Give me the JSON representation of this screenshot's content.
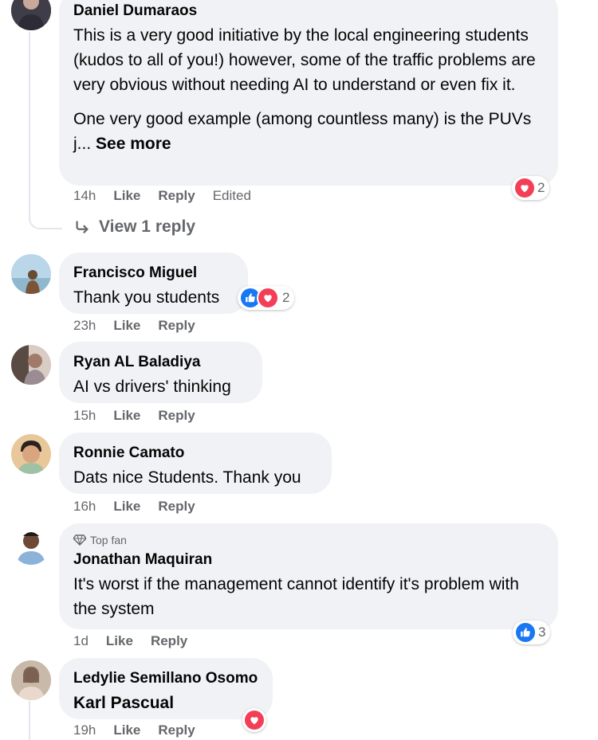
{
  "comments": [
    {
      "author": "Daniel Dumaraos",
      "paragraph1": "This is a very good initiative by the local engineering students (kudos to all of you!) however, some of the traffic problems are very obvious without needing AI to understand or even fix it.",
      "paragraph2": "One very good example (among countless many) is the PUVs j...",
      "see_more": "See more",
      "time": "14h",
      "like": "Like",
      "reply": "Reply",
      "edited": "Edited",
      "reaction_count": "2",
      "view_replies": "View 1 reply"
    },
    {
      "author": "Francisco Miguel",
      "text": "Thank you students",
      "time": "23h",
      "like": "Like",
      "reply": "Reply",
      "reaction_count": "2"
    },
    {
      "author": "Ryan AL Baladiya",
      "text": "AI vs drivers' thinking",
      "time": "15h",
      "like": "Like",
      "reply": "Reply"
    },
    {
      "author": "Ronnie Camato",
      "text": "Dats nice Students. Thank you",
      "time": "16h",
      "like": "Like",
      "reply": "Reply"
    },
    {
      "badge": "Top fan",
      "author": "Jonathan Maquiran",
      "text": "It's worst if the management cannot identify it's problem with the system",
      "time": "1d",
      "like": "Like",
      "reply": "Reply",
      "reaction_count": "3"
    },
    {
      "author": "Ledylie Semillano Osomo",
      "text": "Karl Pascual",
      "time": "19h",
      "like": "Like",
      "reply": "Reply"
    }
  ],
  "colors": {
    "bubble": "#f0f2f5",
    "heart": "#f33e58",
    "like": "#1877f2",
    "muted": "#65676b"
  }
}
